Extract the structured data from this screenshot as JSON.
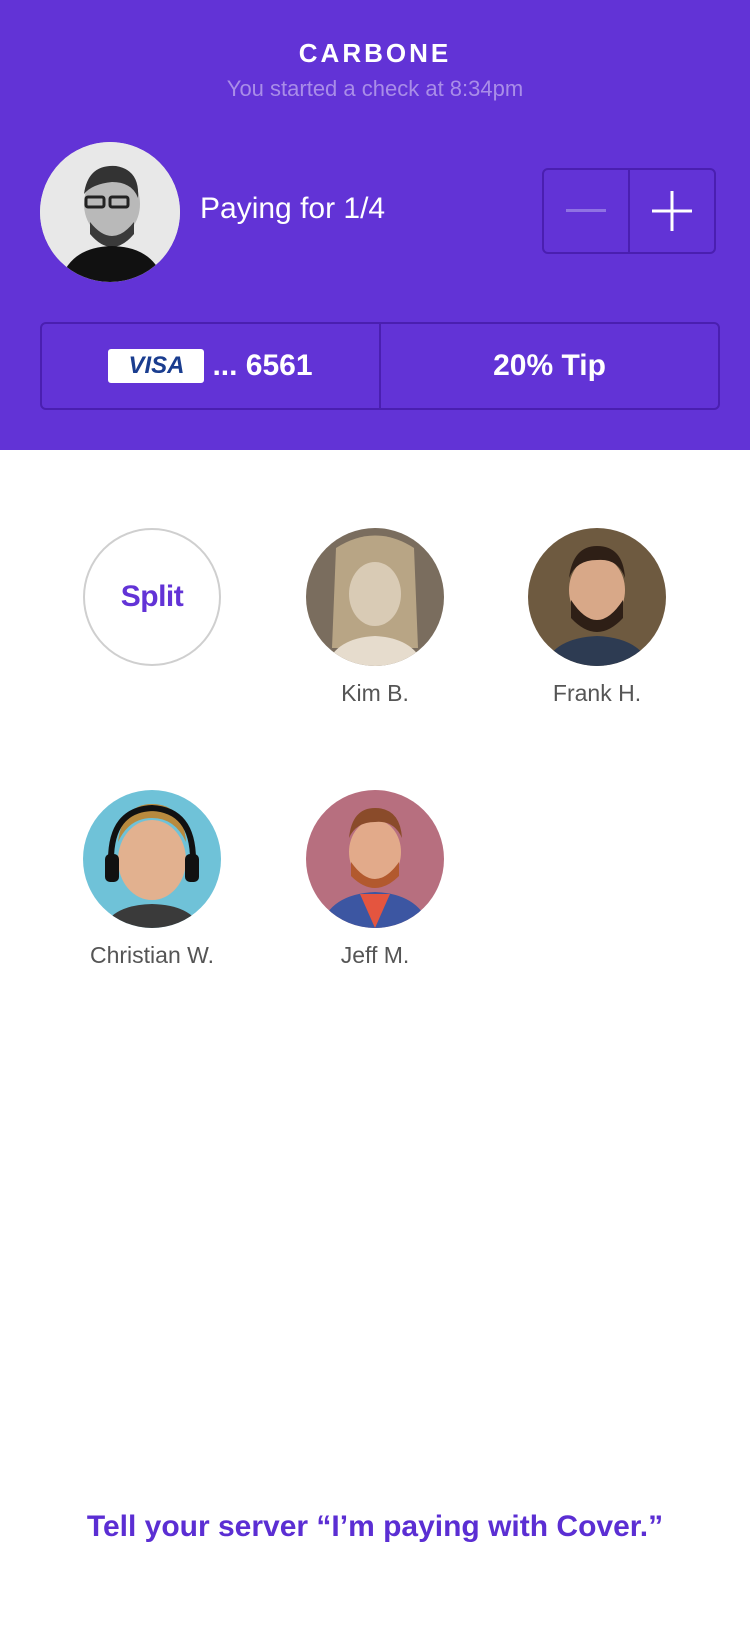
{
  "header": {
    "restaurant": "CARBONE",
    "subtitle": "You started a check at 8:34pm",
    "paying_for": "Paying for 1/4",
    "stepper": {
      "minus_label": "−",
      "plus_label": "+"
    },
    "card": {
      "brand": "VISA",
      "last4": "... 6561"
    },
    "tip": "20% Tip"
  },
  "people": [
    {
      "name": "",
      "label": "Split"
    },
    {
      "name": "Kim B."
    },
    {
      "name": "Frank H."
    },
    {
      "name": "Christian W."
    },
    {
      "name": "Jeff M."
    }
  ],
  "footer": "Tell your server “I’m paying with Cover.”",
  "colors": {
    "brand": "#6233d6",
    "accent_text": "#5b2ed3"
  }
}
